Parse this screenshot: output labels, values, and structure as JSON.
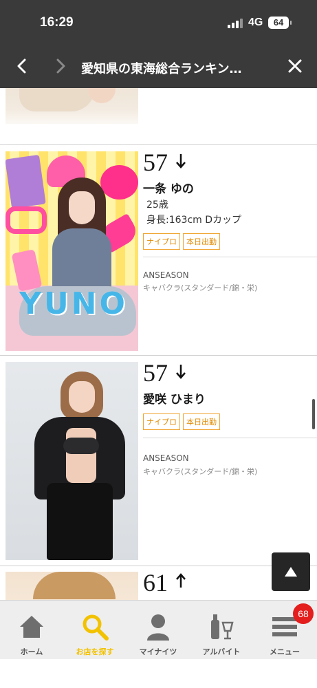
{
  "status_bar": {
    "time": "16:29",
    "network": "4G",
    "battery": "64"
  },
  "nav": {
    "title": "愛知県の東海総合ランキン…",
    "back_icon": "chevron-left-icon",
    "forward_icon": "chevron-right-icon",
    "close_icon": "close-icon"
  },
  "cards": [
    {
      "rank": "57",
      "trend": "down",
      "name": "一条 ゆの",
      "age": "25歳",
      "height": "身長:163cm Dカップ",
      "tags": [
        "ナイプロ",
        "本日出勤"
      ],
      "shop": "ANSEASON",
      "genre": "キャバクラ(スタンダード/錦・栄)",
      "photo_text": "YUNO"
    },
    {
      "rank": "57",
      "trend": "down",
      "name": "愛咲 ひまり",
      "tags": [
        "ナイプロ",
        "本日出勤"
      ],
      "shop": "ANSEASON",
      "genre": "キャバクラ(スタンダード/錦・栄)"
    },
    {
      "rank": "61",
      "trend": "up"
    }
  ],
  "tabbar": {
    "items": [
      {
        "label": "ホーム",
        "icon": "home-icon"
      },
      {
        "label": "お店を探す",
        "icon": "search-icon",
        "active": true
      },
      {
        "label": "マイナイツ",
        "icon": "user-icon"
      },
      {
        "label": "アルバイト",
        "icon": "bottles-icon"
      },
      {
        "label": "メニュー",
        "icon": "menu-icon"
      }
    ],
    "menu_badge": "68"
  },
  "colors": {
    "header_bg": "#3a3a3a",
    "tag_orange": "#f0a531",
    "active_tab": "#f2c200",
    "badge_red": "#e41d1d"
  }
}
